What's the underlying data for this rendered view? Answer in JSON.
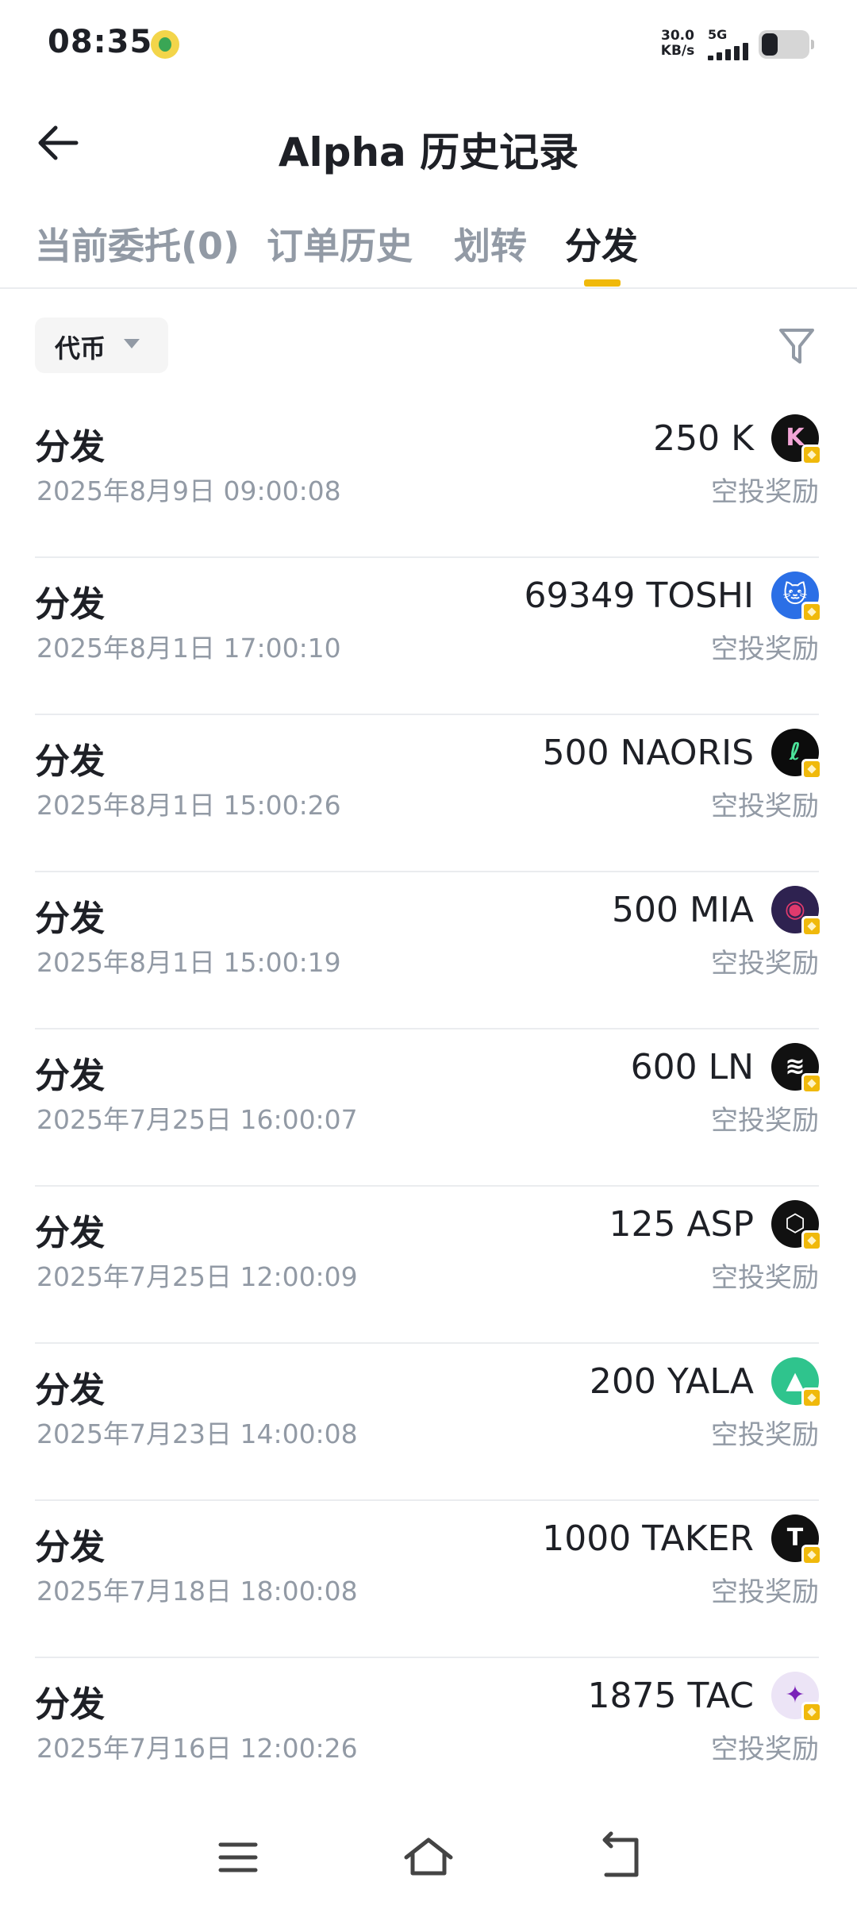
{
  "status_bar": {
    "time": "08:35",
    "net_speed_value": "30.0",
    "net_speed_unit": "KB/s",
    "network": "5G",
    "battery_level": 0.35
  },
  "header": {
    "title": "Alpha 历史记录",
    "back_icon": "arrow-left-icon"
  },
  "tabs": [
    {
      "label": "当前委托(0)",
      "active": false
    },
    {
      "label": "订单历史",
      "active": false
    },
    {
      "label": "划转",
      "active": false
    },
    {
      "label": "分发",
      "active": true
    }
  ],
  "filters": {
    "token_label": "代币",
    "filter_icon": "funnel-icon"
  },
  "records": [
    {
      "type": "分发",
      "time": "2025年8月9日 09:00:08",
      "amount": "250 K",
      "note": "空投奖励",
      "logo_color": "#111111",
      "logo_text": "K",
      "logo_text_color": "#f4a6d7"
    },
    {
      "type": "分发",
      "time": "2025年8月1日 17:00:10",
      "amount": "69349 TOSHI",
      "note": "空投奖励",
      "logo_color": "#2b6fe6",
      "logo_text": "🐱",
      "logo_text_color": "#ffffff"
    },
    {
      "type": "分发",
      "time": "2025年8月1日 15:00:26",
      "amount": "500 NAORIS",
      "note": "空投奖励",
      "logo_color": "#0c0c0c",
      "logo_text": "ℓ",
      "logo_text_color": "#4ce39a"
    },
    {
      "type": "分发",
      "time": "2025年8月1日 15:00:19",
      "amount": "500 MIA",
      "note": "空投奖励",
      "logo_color": "#2e2250",
      "logo_text": "◉",
      "logo_text_color": "#e03a6d"
    },
    {
      "type": "分发",
      "time": "2025年7月25日 16:00:07",
      "amount": "600 LN",
      "note": "空投奖励",
      "logo_color": "#111111",
      "logo_text": "≋",
      "logo_text_color": "#ffffff"
    },
    {
      "type": "分发",
      "time": "2025年7月25日 12:00:09",
      "amount": "125 ASP",
      "note": "空投奖励",
      "logo_color": "#111111",
      "logo_text": "⬡",
      "logo_text_color": "#ffffff"
    },
    {
      "type": "分发",
      "time": "2025年7月23日 14:00:08",
      "amount": "200 YALA",
      "note": "空投奖励",
      "logo_color": "#2fc48d",
      "logo_text": "▲",
      "logo_text_color": "#ffffff"
    },
    {
      "type": "分发",
      "time": "2025年7月18日 18:00:08",
      "amount": "1000 TAKER",
      "note": "空投奖励",
      "logo_color": "#111111",
      "logo_text": "T",
      "logo_text_color": "#ffffff"
    },
    {
      "type": "分发",
      "time": "2025年7月16日 12:00:26",
      "amount": "1875 TAC",
      "note": "空投奖励",
      "logo_color": "#ece4f6",
      "logo_text": "✦",
      "logo_text_color": "#7a22b8"
    }
  ],
  "nav": {
    "menu_icon": "menu-icon",
    "home_icon": "home-icon",
    "back_icon": "back-icon"
  }
}
